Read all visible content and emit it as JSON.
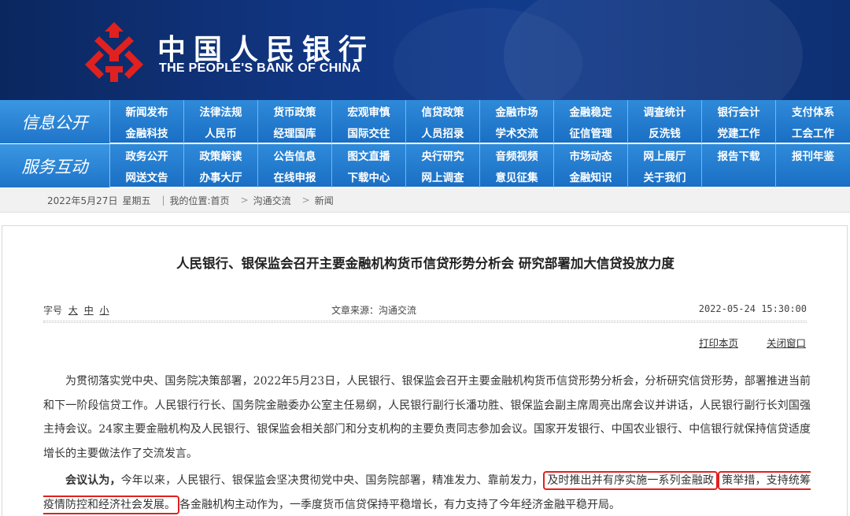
{
  "header": {
    "logo_cn": "中国人民银行",
    "logo_en": "THE PEOPLE'S BANK OF CHINA",
    "brand_red": "#e0211f",
    "brand_blue": "#113580"
  },
  "nav": {
    "row1_label": "信息公开",
    "row2_label": "服务互动",
    "row1_items": [
      "新闻发布",
      "法律法规",
      "货币政策",
      "宏观审慎",
      "信贷政策",
      "金融市场",
      "金融稳定",
      "调查统计",
      "银行会计",
      "支付体系",
      "金融科技",
      "人民币",
      "经理国库",
      "国际交往",
      "人员招录",
      "学术交流",
      "征信管理",
      "反洗钱",
      "党建工作",
      "工会工作"
    ],
    "row2_items": [
      "政务公开",
      "政策解读",
      "公告信息",
      "图文直播",
      "央行研究",
      "音频视频",
      "市场动态",
      "网上展厅",
      "报告下载",
      "报刊年鉴",
      "网送文告",
      "办事大厅",
      "在线申报",
      "下载中心",
      "网上调查",
      "意见征集",
      "金融知识",
      "关于我们",
      "",
      ""
    ]
  },
  "breadcrumb": {
    "date": "2022年5月27日",
    "weekday": "星期五",
    "location_prefix": "我的位置:首页",
    "level1": "沟通交流",
    "level2": "新闻",
    "separator": ">"
  },
  "article": {
    "title": "人民银行、银保监会召开主要金融机构货币信贷形势分析会 研究部署加大信贷投放力度",
    "font_size_label": "字号",
    "font_size_large": "大",
    "font_size_medium": "中",
    "font_size_small": "小",
    "source": "文章来源：沟通交流",
    "datetime": "2022-05-24 15:30:00",
    "print_link": "打印本页",
    "close_link": "关闭窗口",
    "para1": "为贯彻落实党中央、国务院决策部署，2022年5月23日，人民银行、银保监会召开主要金融机构货币信贷形势分析会，分析研究信贷形势，部署推进当前和下一阶段信贷工作。人民银行行长、国务院金融委办公室主任易纲，人民银行副行长潘功胜、银保监会副主席周亮出席会议并讲话，人民银行副行长刘国强主持会议。24家主要金融机构及人民银行、银保监会相关部门和分支机构的主要负责同志参加会议。国家开发银行、中国农业银行、中信银行就保持信贷适度增长的主要做法作了交流发言。",
    "para2_lead": "会议认为，",
    "para2_a": "今年以来，人民银行、银保监会坚决贯彻党中央、国务院部署，精准发力、靠前发力，",
    "para2_highlight_1": "及时推出并有序实施一系列金融政",
    "para2_highlight_2": "策举措，支持统筹疫情防控和经济社会发展。",
    "para2_b": "各金融机构主动作为，一季度货币信贷保持平稳增长，有力支持了今年经济金融平稳开局。",
    "highlight_color": "#e0211f"
  }
}
